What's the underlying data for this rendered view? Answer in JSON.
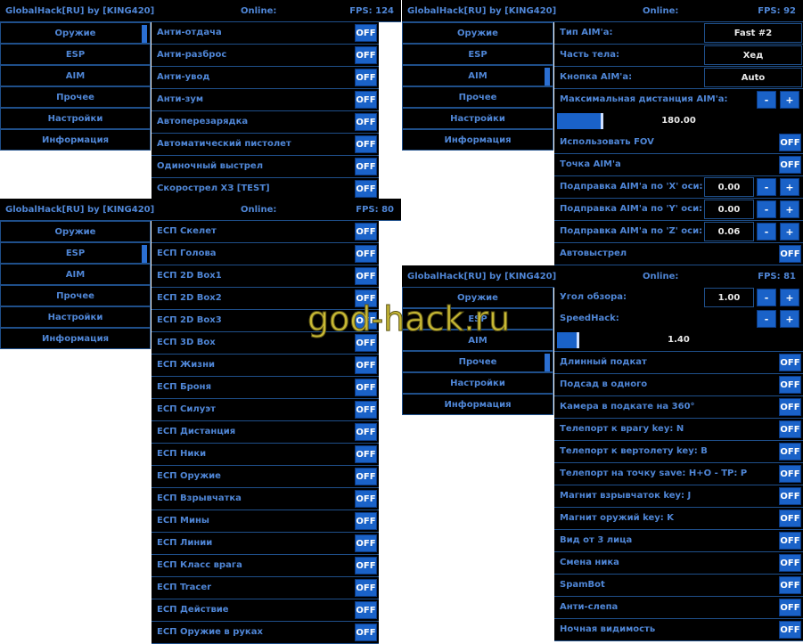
{
  "header": {
    "title": "GlobalHack[RU] by [KING420]",
    "online": "Online:"
  },
  "tabs": [
    "Оружие",
    "ESP",
    "AIM",
    "Прочее",
    "Настройки",
    "Информация"
  ],
  "win1": {
    "fps": "FPS: 124",
    "rows": [
      "Анти-отдача",
      "Анти-разброс",
      "Анти-увод",
      "Анти-зум",
      "Автоперезарядка",
      "Автоматический пистолет",
      "Одиночный выстрел",
      "Скорострел ХЗ [TEST]"
    ]
  },
  "win2": {
    "fps": "FPS: 80",
    "rows": [
      "ЕСП Скелет",
      "ЕСП Голова",
      "ЕСП 2D Box1",
      "ЕСП 2D Box2",
      "ЕСП 2D Box3",
      "ЕСП 3D Box",
      "ЕСП Жизни",
      "ЕСП Броня",
      "ЕСП Силуэт",
      "ЕСП Дистанция",
      "ЕСП Ники",
      "ЕСП Оружие",
      "ЕСП Взрывчатка",
      "ЕСП Мины",
      "ЕСП Линии",
      "ЕСП Класс врага",
      "ЕСП Tracer",
      "ЕСП Действие",
      "ЕСП Оружие в руках"
    ]
  },
  "win3": {
    "fps": "FPS: 92",
    "aim_type": {
      "label": "Тип AIM'а:",
      "value": "Fast #2"
    },
    "body_part": {
      "label": "Часть тела:",
      "value": "Хед"
    },
    "aim_key": {
      "label": "Кнопка AIM'а:",
      "value": "Auto"
    },
    "max_dist": {
      "label": "Максимальная дистанция AIM'а:",
      "value": "180.00",
      "fill": 0.18
    },
    "fov": "Использовать FOV",
    "aim_point": "Точка AIM'а",
    "corr_x": {
      "label": "Подправка AIM'а по 'X' оси:",
      "value": "0.00"
    },
    "corr_y": {
      "label": "Подправка AIM'а по 'Y' оси:",
      "value": "0.00"
    },
    "corr_z": {
      "label": "Подправка AIM'а по 'Z' оси:",
      "value": "0.06"
    },
    "autoshot": "Автовыстрел"
  },
  "win4": {
    "fps": "FPS: 81",
    "fov_angle": {
      "label": "Угол обзора:",
      "value": "1.00"
    },
    "speedhack": {
      "label": "SpeedHack:",
      "value": "1.40",
      "fill": 0.08
    },
    "rows": [
      "Длинный подкат",
      "Подсад в одного",
      "Камера в подкате на 360°",
      "Телепорт к врагу key: N",
      "Телепорт к вертолету key: B",
      "Телепорт на точку save: H+O - TP: P",
      "Магнит взрывчаток key: J",
      "Магнит оружий key: K",
      "Вид от 3 лица",
      "Смена ника",
      "SpamBot",
      "Анти-слепа",
      "Ночная видимость"
    ]
  },
  "off_label": "OFF",
  "minus": "-",
  "plus": "+",
  "watermark": "god-hack.ru",
  "colors": {
    "accent": "#1a62c8",
    "text": "#4f86d6",
    "border": "#1f4f8a",
    "bg": "#000000"
  }
}
